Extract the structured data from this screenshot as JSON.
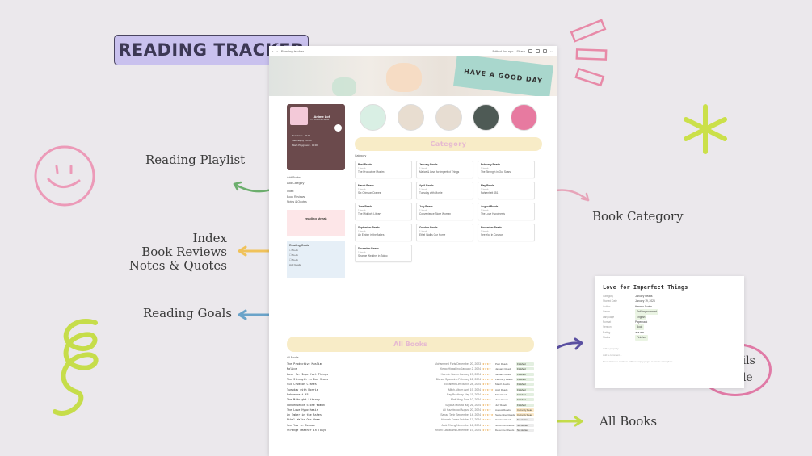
{
  "title": "READING TRACKER",
  "callouts": {
    "playlist": "Reading Playlist",
    "index": "Index",
    "reviews": "Book Reviews",
    "notes": "Notes & Quotes",
    "goals": "Reading Goals",
    "category": "Book Category",
    "all_books": "All Books",
    "details": "Details\nInside"
  },
  "colors": {
    "badge": "#c9c1ee",
    "pink_circle": "#e07aa6",
    "green_star": "#cbe04a",
    "arrow_green": "#6cae6d",
    "arrow_yellow": "#f0c25a",
    "arrow_blue": "#6aa3c9",
    "arrow_pink": "#e7a4b9",
    "arrow_purple": "#5a4fa1",
    "arrow_lime": "#c4dc4a"
  },
  "window": {
    "tab": "Reading tracker",
    "topbar_right": "Edited 1m ago",
    "share": "Share",
    "cover_sign": "HAVE A GOOD DAY",
    "page_title": "Reading tracker",
    "add_property": "Add property",
    "add_comment": "Add a comment...",
    "back": "Back to Homepage",
    "player": {
      "title": "Anime Lofi",
      "subtitle": "The Lofi Chill Playlist",
      "button": "Preview on Spotify",
      "tracks": [
        {
          "name": "Sunflower",
          "time": "03:03"
        },
        {
          "name": "Serendipity",
          "time": "03:00"
        },
        {
          "name": "Mai's Playground",
          "time": "03:00"
        }
      ]
    },
    "nav_add": [
      "Add Books",
      "Add Category"
    ],
    "nav_index": [
      "Index",
      "Book Reviews",
      "Notes & Quotes"
    ],
    "streak": "reading streak",
    "goals_title": "Reading Goals",
    "goals_items": [
      "To-do",
      "To-do",
      "To-do"
    ],
    "add_goals": "Add Goals",
    "category_banner": "Category",
    "category_label": "Category",
    "categories": [
      {
        "name": "Past Reads",
        "count": "1 book",
        "book": "The Productive Muslim"
      },
      {
        "name": "January Reads",
        "count": "1 book",
        "book": "Malice & Love for Imperfect Things"
      },
      {
        "name": "February Reads",
        "count": "1 book",
        "book": "The Strength in Our Scars"
      },
      {
        "name": "March Reads",
        "count": "1 book",
        "book": "Six Crimson Cranes"
      },
      {
        "name": "April Reads",
        "count": "1 book",
        "book": "Tuesday with Morrie"
      },
      {
        "name": "May Reads",
        "count": "1 book",
        "book": "Fahrenheit 451"
      },
      {
        "name": "June Reads",
        "count": "1 book",
        "book": "The Midnight Library"
      },
      {
        "name": "July Reads",
        "count": "1 book",
        "book": "Convenience Store Woman"
      },
      {
        "name": "August Reads",
        "count": "1 book",
        "book": "The Love Hypothesis"
      },
      {
        "name": "September Reads",
        "count": "1 book",
        "book": "An Ember in the Ashes"
      },
      {
        "name": "October Reads",
        "count": "1 book",
        "book": "Ethel Walks Our Home"
      },
      {
        "name": "November Reads",
        "count": "1 book",
        "book": "See You in Cosmos"
      },
      {
        "name": "December Reads",
        "count": "1 book",
        "book": "Strange Weather in Tokyo"
      }
    ],
    "all_books_banner": "All Books",
    "all_books_label": "All Books",
    "books": [
      {
        "title": "The Productive Muslim",
        "author": "Mohammed Faris",
        "date": "December 20, 2023",
        "stars": "★★★★",
        "cat": "Past Reads",
        "status": "Finished"
      },
      {
        "title": "Malice",
        "author": "Keigo Higashino",
        "date": "January 2, 2024",
        "stars": "★★★★",
        "cat": "January Reads",
        "status": "Finished"
      },
      {
        "title": "Love for Imperfect Things",
        "author": "Haemin Sunim",
        "date": "January 19, 2024",
        "stars": "★★★★",
        "cat": "January Reads",
        "status": "Finished"
      },
      {
        "title": "The Strength in Our Scars",
        "author": "Bianca Sparacino",
        "date": "February 12, 2024",
        "stars": "★★★★★",
        "cat": "February Reads",
        "status": "Finished"
      },
      {
        "title": "Six Crimson Cranes",
        "author": "Elizabeth Lim",
        "date": "March 28, 2024",
        "stars": "★★★★",
        "cat": "March Reads",
        "status": "Finished"
      },
      {
        "title": "Tuesday with Morrie",
        "author": "Mitch Albom",
        "date": "April 19, 2024",
        "stars": "★★★★★",
        "cat": "April Reads",
        "status": "Finished"
      },
      {
        "title": "Fahrenheit 451",
        "author": "Ray Bradbury",
        "date": "May 11, 2024",
        "stars": "★★★",
        "cat": "May Reads",
        "status": "Finished"
      },
      {
        "title": "The Midnight Library",
        "author": "Matt Haig",
        "date": "June 10, 2024",
        "stars": "★★★★",
        "cat": "June Reads",
        "status": "Finished"
      },
      {
        "title": "Convenience Store Woman",
        "author": "Sayaka Murata",
        "date": "July 26, 2024",
        "stars": "★★★★",
        "cat": "July Reads",
        "status": "Finished"
      },
      {
        "title": "The Love Hypothesis",
        "author": "Ali Hazelwood",
        "date": "August 20, 2024",
        "stars": "★★★★",
        "cat": "August Reads",
        "status": "Currently Read"
      },
      {
        "title": "An Ember in the Ashes",
        "author": "Sabaa Tahir",
        "date": "September 14, 2024",
        "stars": "★★★★★",
        "cat": "September Reads",
        "status": "Currently Read"
      },
      {
        "title": "Ethel Walks Our Home",
        "author": "Hannah Kaner",
        "date": "October 17, 2024",
        "stars": "★★★★",
        "cat": "October Reads",
        "status": "Not started"
      },
      {
        "title": "See You in Cosmos",
        "author": "Jack Cheng",
        "date": "November 16, 2024",
        "stars": "★★★★",
        "cat": "November Reads",
        "status": "Not started"
      },
      {
        "title": "Strange Weather in Tokyo",
        "author": "Hiromi Kawakami",
        "date": "December 19, 2024",
        "stars": "★★★★",
        "cat": "December Reads",
        "status": "Not started"
      }
    ]
  },
  "detail": {
    "title": "Love for Imperfect Things",
    "props": [
      {
        "k": "Category",
        "v": "January Reads",
        "tag": false
      },
      {
        "k": "Started Date",
        "v": "January 19, 2024",
        "tag": false
      },
      {
        "k": "Author",
        "v": "Haemin Sunim",
        "tag": false
      },
      {
        "k": "Genre",
        "v": "Self-Improvement",
        "tag": true
      },
      {
        "k": "Language",
        "v": "English",
        "tag": true
      },
      {
        "k": "Format",
        "v": "Paperback",
        "tag": false
      },
      {
        "k": "Version",
        "v": "Book",
        "tag": true
      },
      {
        "k": "Rating",
        "v": "★★★★",
        "tag": false
      },
      {
        "k": "Status",
        "v": "Finished",
        "tag": true
      }
    ],
    "add_property": "Add a property",
    "add_comment": "Add a comment...",
    "footer": "Press Enter to continue with an empty page, or create a template"
  }
}
